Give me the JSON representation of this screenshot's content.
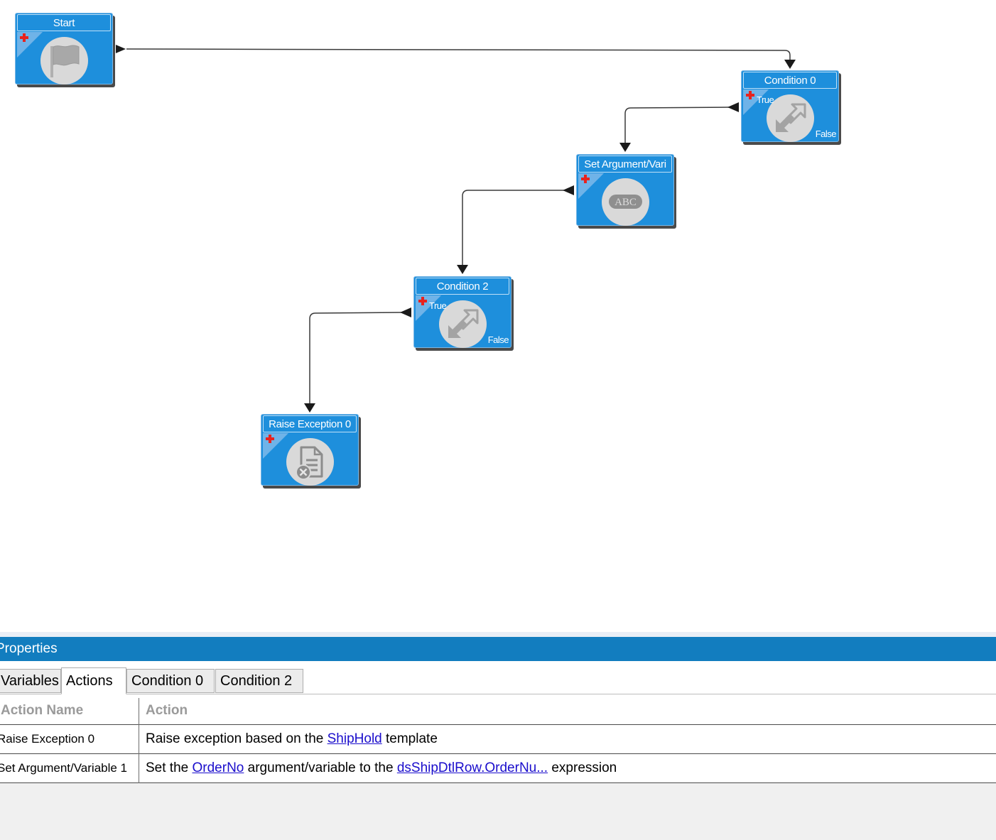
{
  "workflow": {
    "nodes": [
      {
        "id": "start",
        "title": "Start",
        "icon": "flag-icon"
      },
      {
        "id": "condition0",
        "title": "Condition 0",
        "icon": "condition-arrows-icon",
        "true_label": "True",
        "false_label": "False"
      },
      {
        "id": "setarg",
        "title": "Set Argument/Vari",
        "icon": "abc-icon",
        "icon_text": "ABC"
      },
      {
        "id": "condition2",
        "title": "Condition 2",
        "icon": "condition-arrows-icon",
        "true_label": "True",
        "false_label": "False"
      },
      {
        "id": "raise",
        "title": "Raise Exception 0",
        "icon": "document-error-icon"
      }
    ],
    "connections": [
      {
        "from": "Start",
        "to": "Condition 0"
      },
      {
        "from": "Condition 0",
        "port": "True",
        "to": "Set Argument/Vari"
      },
      {
        "from": "Set Argument/Vari",
        "to": "Condition 2"
      },
      {
        "from": "Condition 2",
        "port": "True",
        "to": "Raise Exception 0"
      }
    ],
    "colors": {
      "node_fill": "#1e8fdc",
      "add_icon": "#e8221e",
      "icon_circle": "#d9d9d9"
    }
  },
  "properties": {
    "title": "Properties",
    "tabs": [
      {
        "label": "Variables",
        "active": false
      },
      {
        "label": "Actions",
        "active": true
      },
      {
        "label": "Condition 0",
        "active": false
      },
      {
        "label": "Condition 2",
        "active": false
      }
    ],
    "table": {
      "columns": [
        "Action Name",
        "Action"
      ],
      "rows": [
        {
          "name": "Raise Exception 0",
          "action": {
            "pre": "Raise exception based on the ",
            "link1": "ShipHold",
            "mid": " template"
          }
        },
        {
          "name": "Set Argument/Variable 1",
          "action": {
            "pre": "Set the ",
            "link1": "OrderNo",
            "mid": " argument/variable to the ",
            "link2": "dsShipDtlRow.OrderNu...",
            "post": " expression"
          }
        }
      ]
    },
    "colors": {
      "header_bg": "#127dbf",
      "link": "#1a0dcc"
    }
  }
}
